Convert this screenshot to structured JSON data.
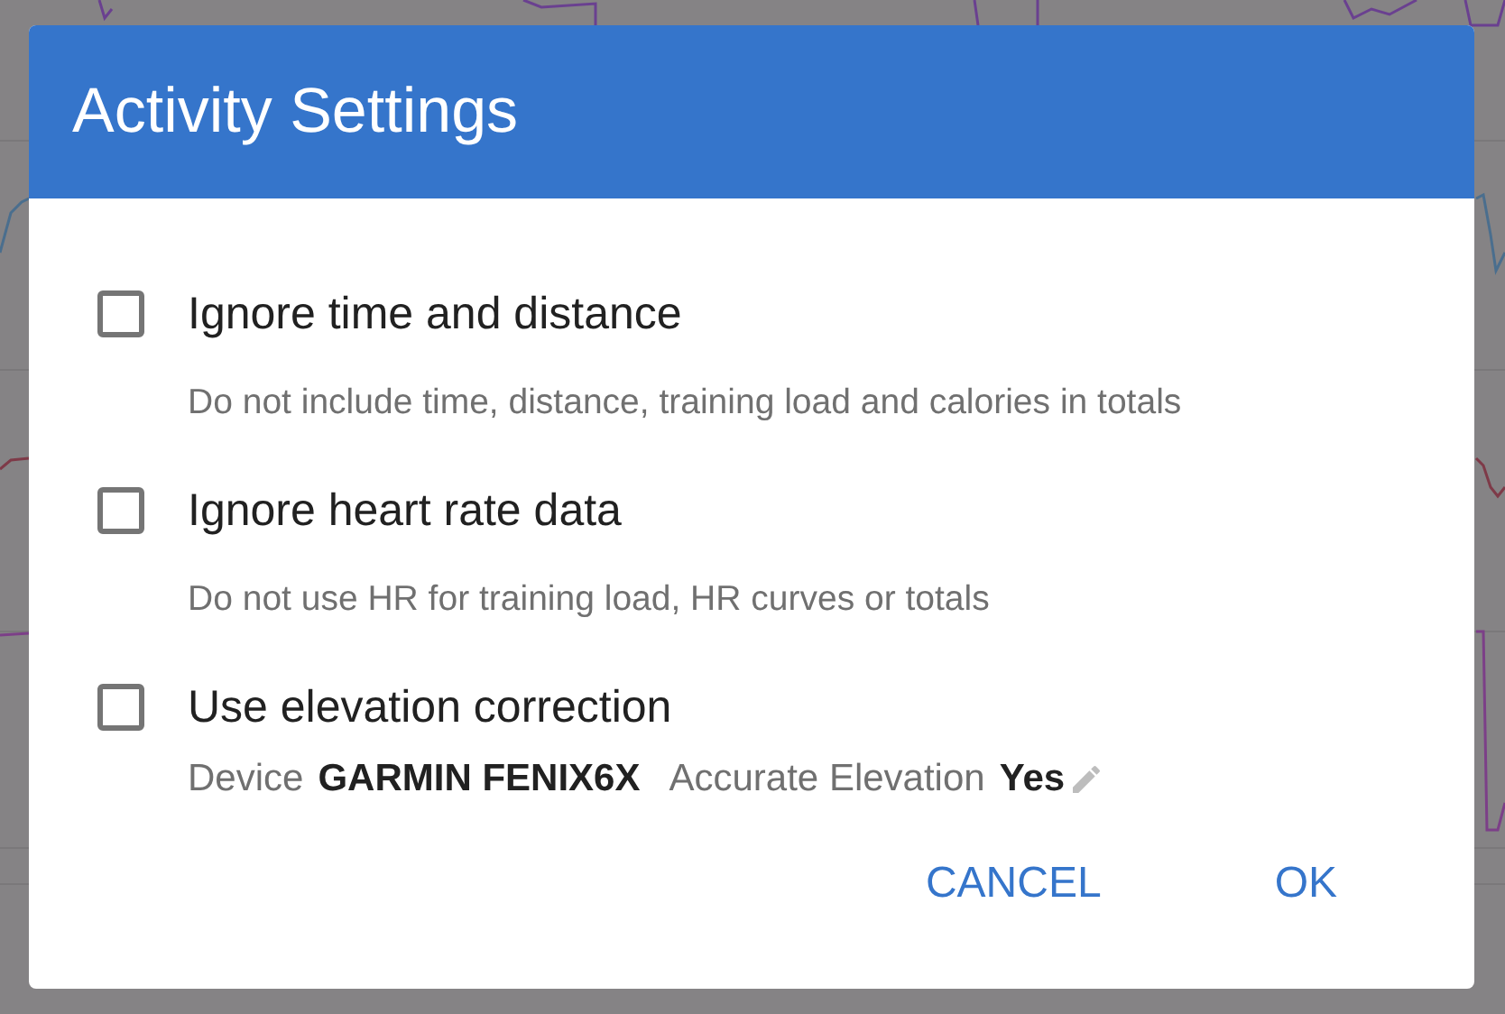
{
  "dialog": {
    "title": "Activity Settings",
    "options": [
      {
        "kind": "text",
        "label": "Ignore time and distance",
        "checked": false,
        "description": "Do not include time, distance, training load and calories in totals"
      },
      {
        "kind": "text",
        "label": "Ignore heart rate data",
        "checked": false,
        "description": "Do not use HR for training load, HR curves or totals"
      },
      {
        "kind": "fields",
        "label": "Use elevation correction",
        "checked": false,
        "fields": [
          {
            "label": "Device",
            "value": "GARMIN FENIX6X"
          },
          {
            "label": "Accurate Elevation",
            "value": "Yes",
            "editable": true
          }
        ]
      }
    ],
    "buttons": [
      "CANCEL",
      "OK"
    ]
  }
}
